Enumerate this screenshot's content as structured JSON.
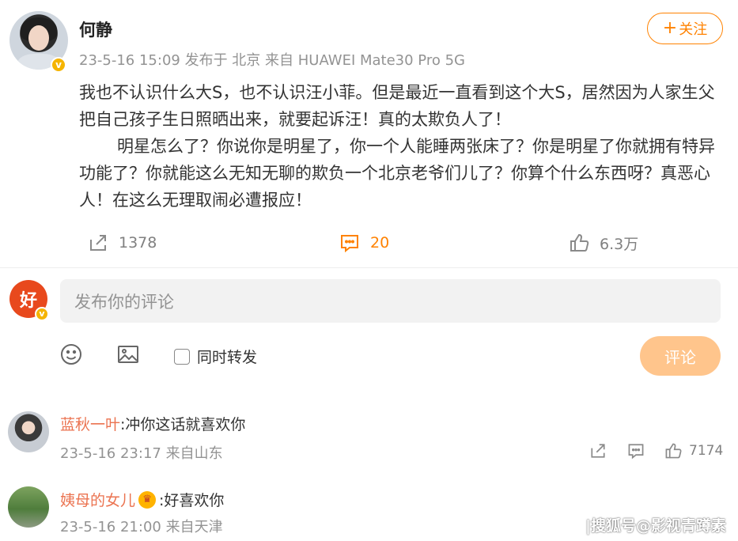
{
  "post": {
    "author": "何静",
    "meta": "23-5-16 15:09  发布于 北京  来自 HUAWEI Mate30 Pro 5G",
    "follow_label": "关注",
    "follow_prefix": "+",
    "paragraph1": "我也不认识什么大S，也不认识汪小菲。但是最近一直看到这个大S，居然因为人家生父把自己孩子生日照晒出来，就要起诉汪！真的太欺负人了！",
    "paragraph2": "明星怎么了？你说你是明星了，你一个人能睡两张床了？你是明星了你就拥有特异功能了？你就能这么无知无聊的欺负一个北京老爷们儿了？你算个什么东西呀？真恶心人！在这么无理取闹必遭报应！",
    "forward_count": "1378",
    "comment_count": "20",
    "like_count": "6.3万"
  },
  "composer": {
    "avatar_text": "好",
    "placeholder": "发布你的评论",
    "repost_label": "同时转发",
    "submit_label": "评论"
  },
  "comments": [
    {
      "user": "蓝秋一叶",
      "text": ":冲你这话就喜欢你",
      "meta": "23-5-16 23:17  来自山东",
      "like_count": "7174"
    },
    {
      "user": "姨母的女儿",
      "text": ":好喜欢你",
      "meta": "23-5-16 21:00  来自天津"
    }
  ],
  "watermark": "|搜狐号@影视青蹲素",
  "colors": {
    "accent": "#ff8200",
    "username": "#eb7350",
    "submit_disabled": "#ffc58c",
    "meta_gray": "#939393"
  }
}
